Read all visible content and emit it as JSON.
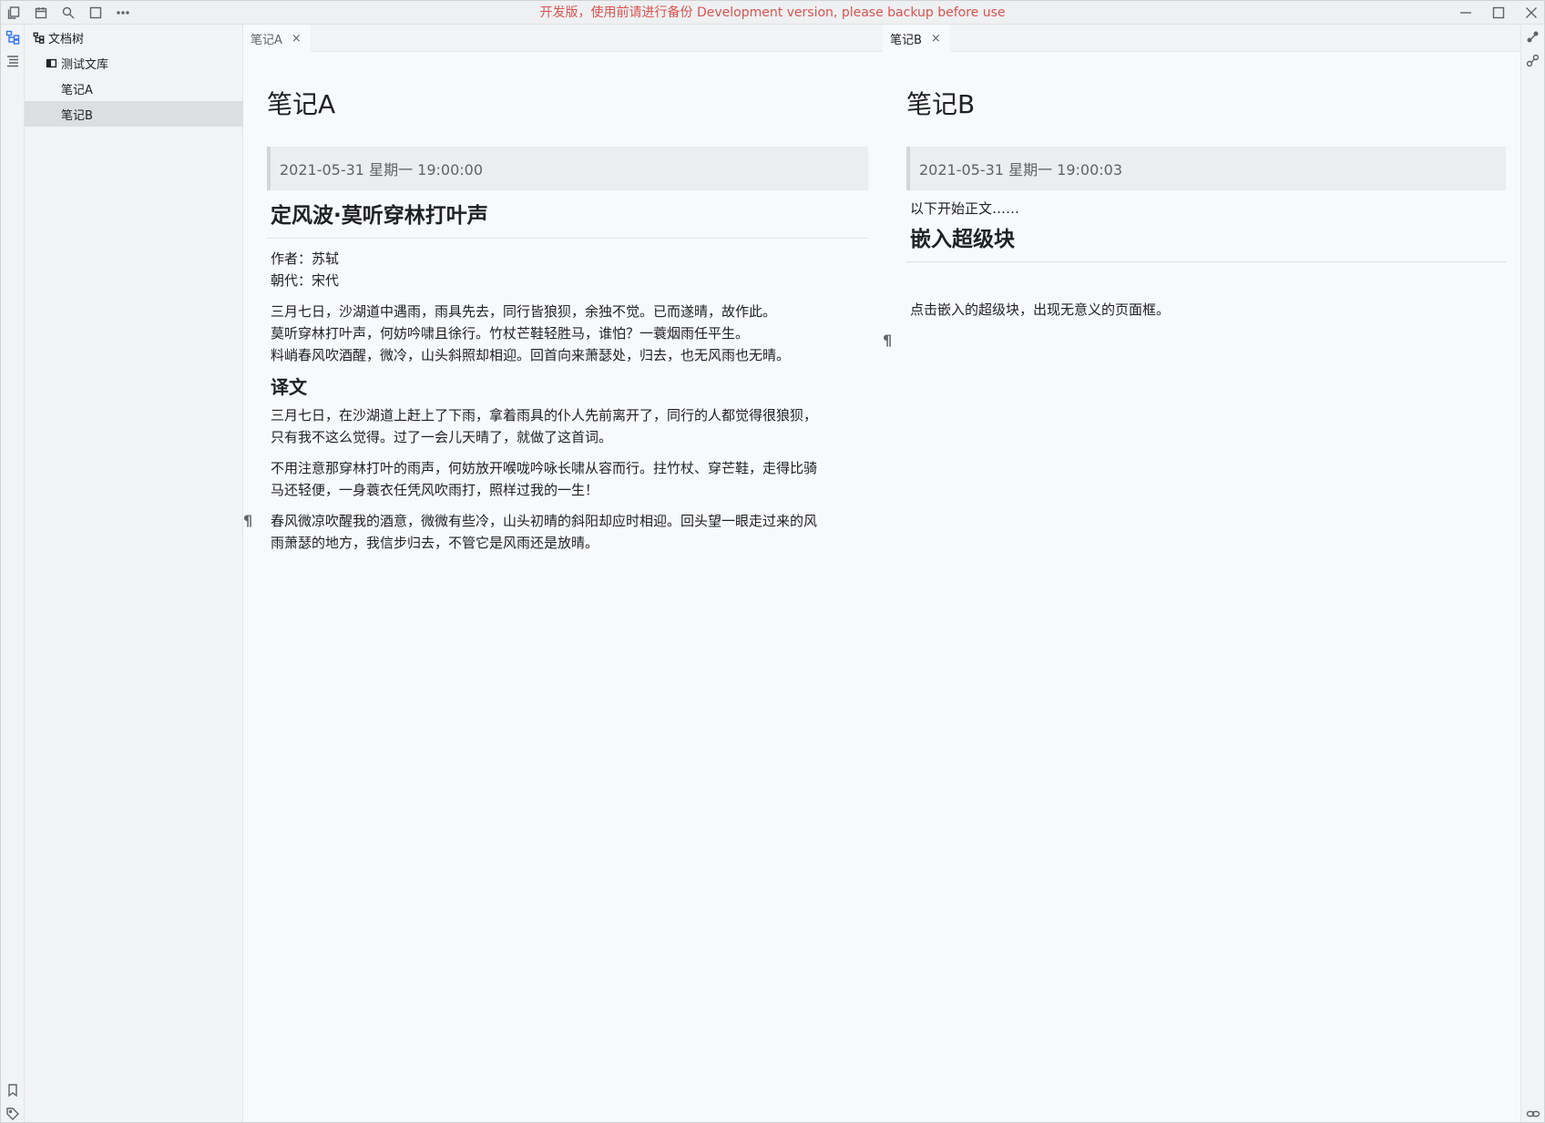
{
  "titlebar": {
    "notice": "开发版，使用前请进行备份 Development version, please backup before use",
    "icons": [
      "files-icon",
      "calendar-icon",
      "search-icon",
      "layout-icon",
      "more-icon"
    ],
    "window_controls": [
      "minimize-icon",
      "maximize-icon",
      "close-icon"
    ]
  },
  "sidebar": {
    "header": "文档树",
    "notebook": "测试文库",
    "docs": [
      {
        "label": "笔记A",
        "selected": false
      },
      {
        "label": "笔记B",
        "selected": true
      }
    ]
  },
  "pane_a": {
    "tab": {
      "label": "笔记A",
      "close": "×"
    },
    "title": "笔记A",
    "date": "2021-05-31 星期一 19:00:00",
    "heading": "定风波·莫听穿林打叶声",
    "meta": [
      "作者：苏轼",
      "朝代：宋代"
    ],
    "poem": [
      "三月七日，沙湖道中遇雨，雨具先去，同行皆狼狈，余独不觉。已而遂晴，故作此。",
      "莫听穿林打叶声，何妨吟啸且徐行。竹杖芒鞋轻胜马，谁怕？一蓑烟雨任平生。",
      "料峭春风吹酒醒，微冷，山头斜照却相迎。回首向来萧瑟处，归去，也无风雨也无晴。"
    ],
    "subheading": "译文",
    "translation": [
      [
        "三月七日，在沙湖道上赶上了下雨，拿着雨具的仆人先前离开了，同行的人都觉得很狼狈，",
        "只有我不这么觉得。过了一会儿天晴了，就做了这首词。"
      ],
      [
        "不用注意那穿林打叶的雨声，何妨放开喉咙吟咏长啸从容而行。拄竹杖、穿芒鞋，走得比骑",
        "马还轻便，一身蓑衣任凭风吹雨打，照样过我的一生！"
      ],
      [
        "春风微凉吹醒我的酒意，微微有些冷，山头初晴的斜阳却应时相迎。回头望一眼走过来的风",
        "雨萧瑟的地方，我信步归去，不管它是风雨还是放晴。"
      ]
    ],
    "pilcrow": "¶"
  },
  "pane_b": {
    "tab": {
      "label": "笔记B",
      "close": "×"
    },
    "title": "笔记B",
    "date": "2021-05-31 星期一 19:00:03",
    "intro": "以下开始正文……",
    "heading": "嵌入超级块",
    "note": "点击嵌入的超级块，出现无意义的页面框。",
    "pilcrow": "¶"
  },
  "colors": {
    "notice": "#d9534f",
    "accent": "#3575f0",
    "selected_bg": "#dcdee0"
  }
}
